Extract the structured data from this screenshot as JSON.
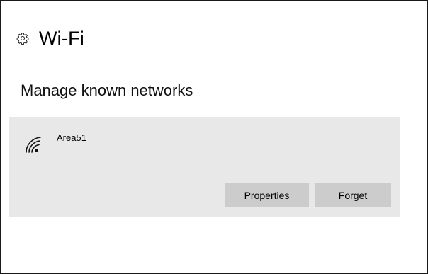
{
  "header": {
    "icon": "gear-icon",
    "title": "Wi-Fi"
  },
  "section": {
    "heading": "Manage known networks"
  },
  "networks": [
    {
      "icon": "wifi-signal-icon",
      "name": "Area51",
      "actions": {
        "properties_label": "Properties",
        "forget_label": "Forget"
      }
    }
  ],
  "colors": {
    "card_background": "#e8e8e8",
    "button_background": "#cccccc"
  }
}
